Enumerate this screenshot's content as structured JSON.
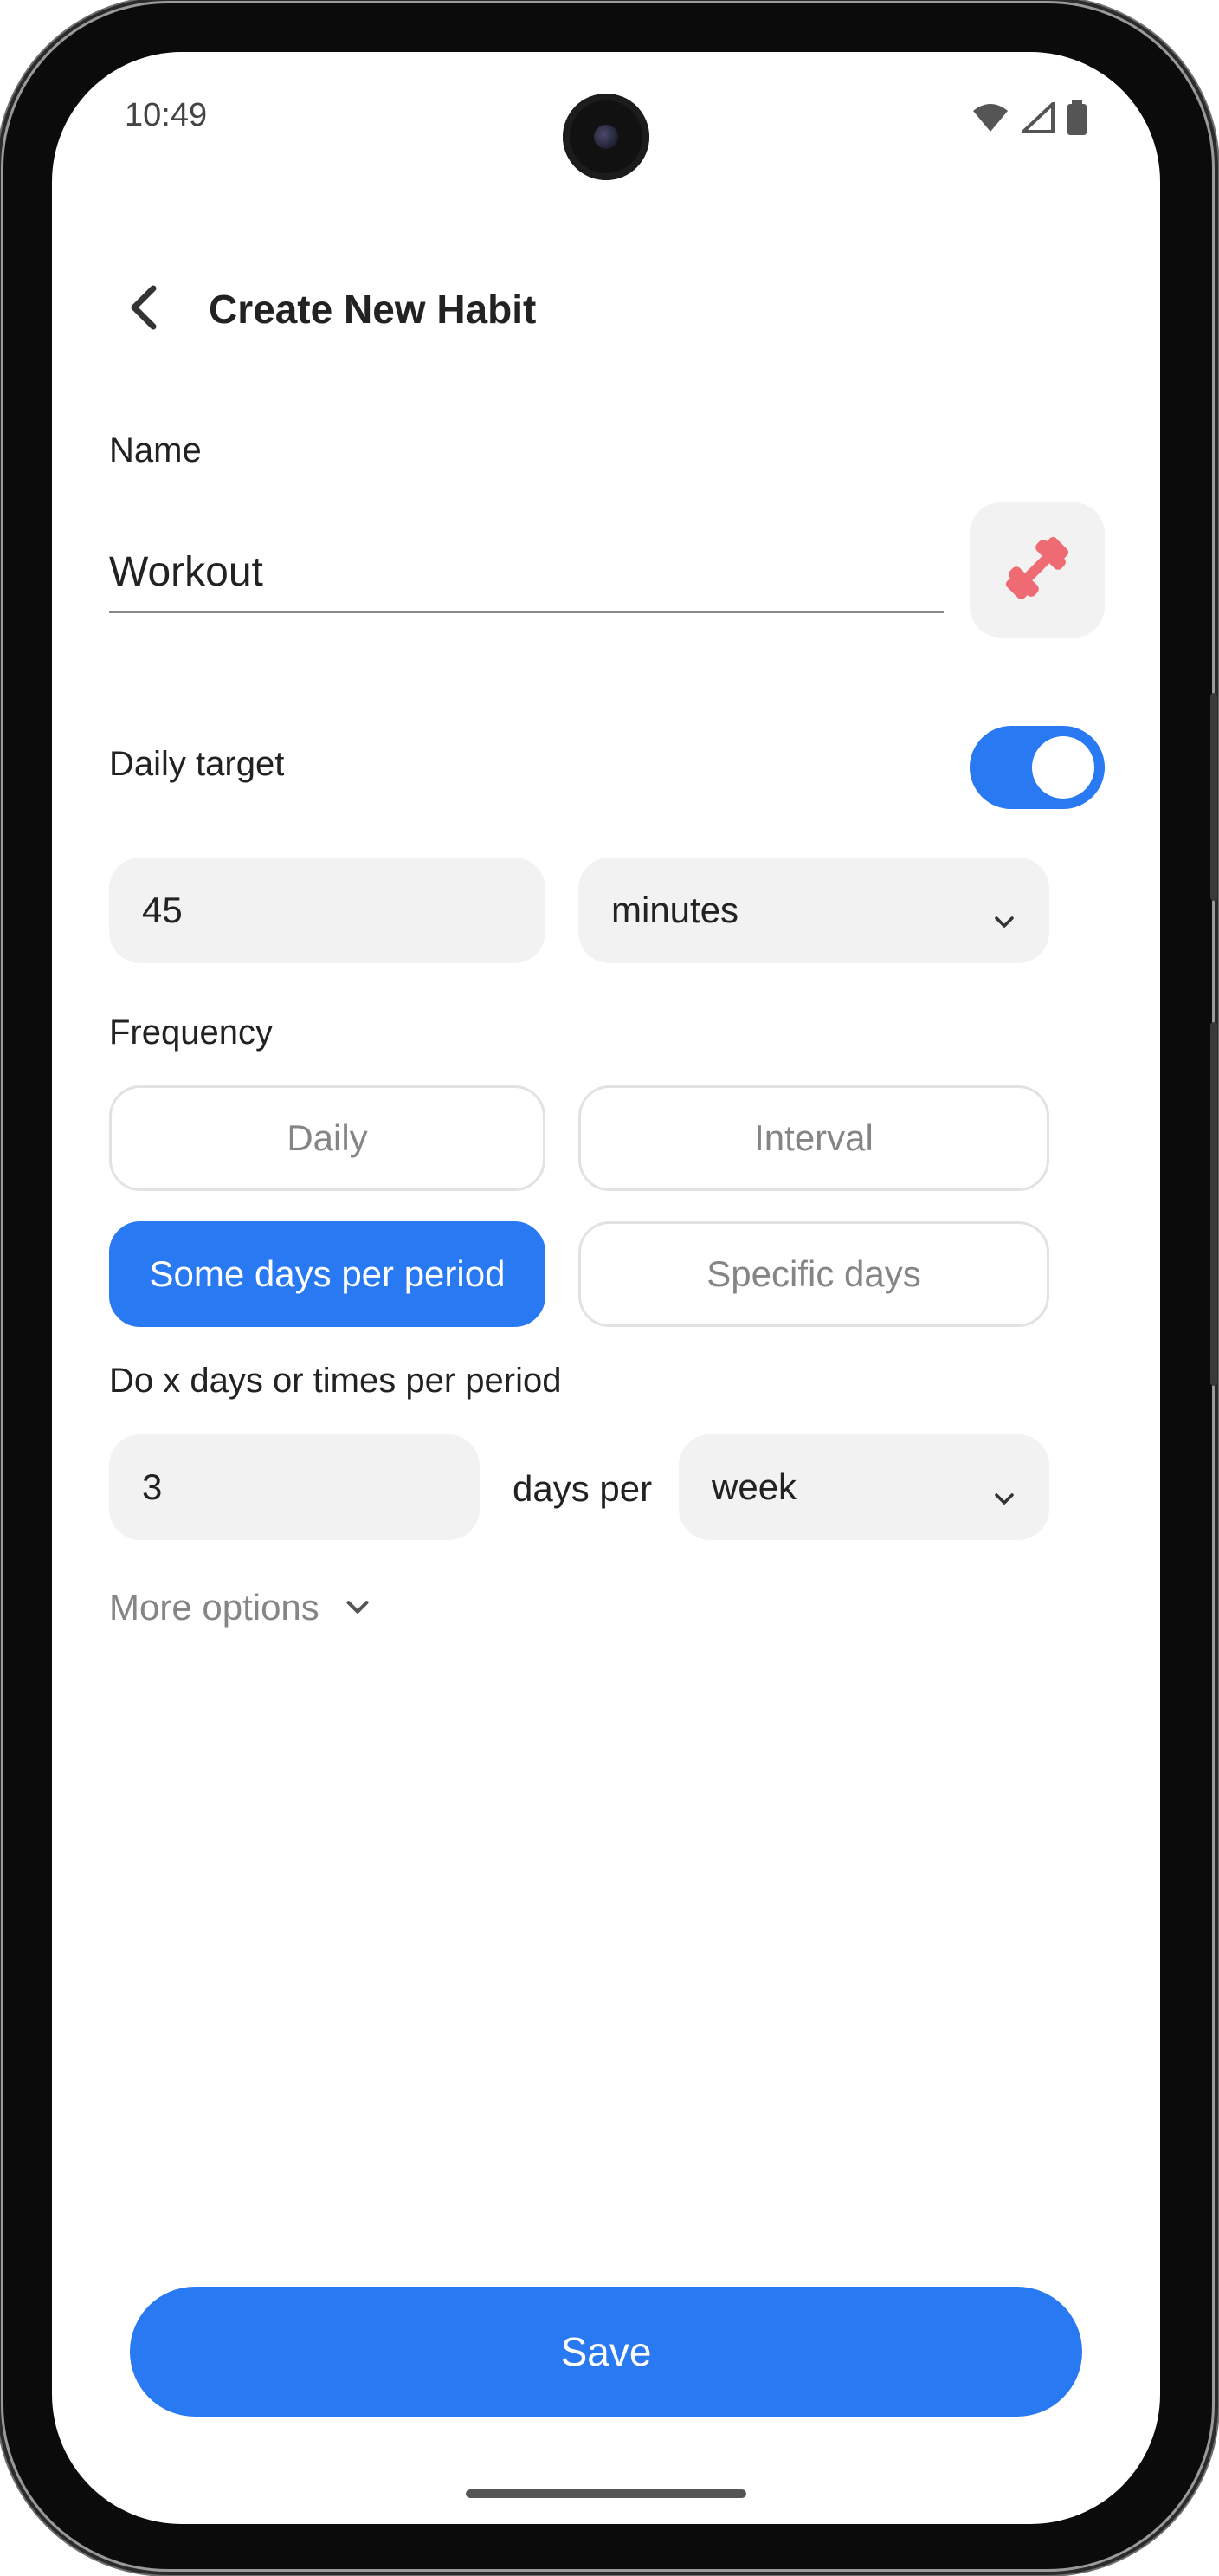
{
  "status_bar": {
    "time": "10:49",
    "icons": [
      "wifi-icon",
      "signal-icon",
      "battery-icon"
    ]
  },
  "header": {
    "back_icon": "chevron-left-icon",
    "title": "Create New Habit"
  },
  "name_section": {
    "label": "Name",
    "value": "Workout",
    "habit_icon": "dumbbell-icon",
    "habit_icon_color": "#ef6b73"
  },
  "daily_target": {
    "label": "Daily target",
    "enabled": true,
    "amount": "45",
    "unit": "minutes"
  },
  "frequency": {
    "label": "Frequency",
    "options": [
      {
        "label": "Daily",
        "selected": false
      },
      {
        "label": "Interval",
        "selected": false
      },
      {
        "label": "Some days per period",
        "selected": true
      },
      {
        "label": "Specific days",
        "selected": false
      }
    ],
    "hint": "Do x days or times per period",
    "count": "3",
    "per_text": "days per",
    "period": "week"
  },
  "more_options": {
    "label": "More options",
    "icon": "chevron-down-icon"
  },
  "save_label": "Save",
  "colors": {
    "accent": "#2979f2",
    "field_bg": "#f2f2f2",
    "muted_text": "#858585"
  }
}
